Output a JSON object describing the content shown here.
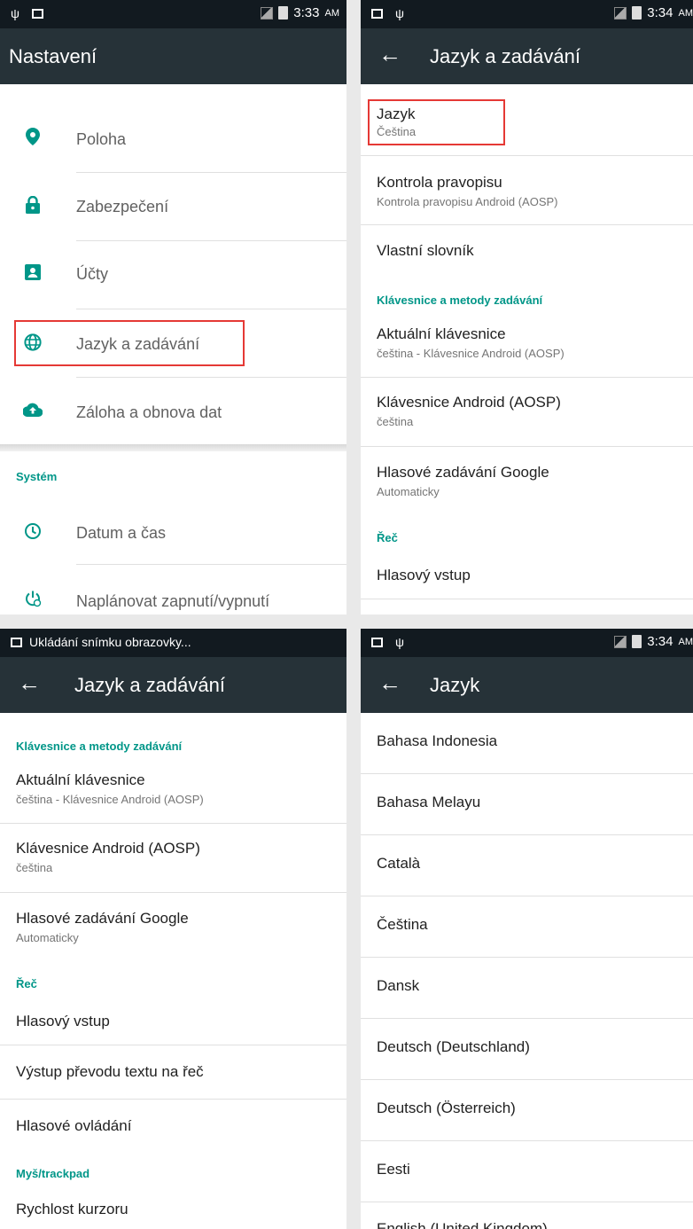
{
  "panel1": {
    "time": "3:33",
    "ampm": "AM",
    "title": "Nastavení",
    "items": [
      {
        "label": "Poloha",
        "icon": "location-pin-icon"
      },
      {
        "label": "Zabezpečení",
        "icon": "lock-icon"
      },
      {
        "label": "Účty",
        "icon": "account-icon"
      },
      {
        "label": "Jazyk a zadávání",
        "icon": "globe-icon"
      },
      {
        "label": "Záloha a obnova dat",
        "icon": "cloud-upload-icon"
      }
    ],
    "system_header": "Systém",
    "system_items": [
      {
        "label": "Datum a čas",
        "icon": "clock-icon"
      },
      {
        "label": "Naplánovat zapnutí/vypnutí",
        "icon": "power-schedule-icon"
      }
    ]
  },
  "panel2": {
    "time": "3:34",
    "ampm": "AM",
    "title": "Jazyk a zadávání",
    "language": {
      "label": "Jazyk",
      "value": "Čeština"
    },
    "spellcheck": {
      "label": "Kontrola pravopisu",
      "value": "Kontrola pravopisu Android (AOSP)"
    },
    "dictionary": "Vlastní slovník",
    "keyboard_header": "Klávesnice a metody zadávání",
    "current_keyboard": {
      "label": "Aktuální klávesnice",
      "value": "čeština - Klávesnice Android (AOSP)"
    },
    "aosp_keyboard": {
      "label": "Klávesnice Android (AOSP)",
      "value": "čeština"
    },
    "google_voice": {
      "label": "Hlasové zadávání Google",
      "value": "Automaticky"
    },
    "speech_header": "Řeč",
    "voice_input": "Hlasový vstup"
  },
  "panel3": {
    "status_text": "Ukládání snímku obrazovky...",
    "title": "Jazyk a zadávání",
    "keyboard_header": "Klávesnice a metody zadávání",
    "current_keyboard": {
      "label": "Aktuální klávesnice",
      "value": "čeština - Klávesnice Android (AOSP)"
    },
    "aosp_keyboard": {
      "label": "Klávesnice Android (AOSP)",
      "value": "čeština"
    },
    "google_voice": {
      "label": "Hlasové zadávání Google",
      "value": "Automaticky"
    },
    "speech_header": "Řeč",
    "voice_input": "Hlasový vstup",
    "tts_output": "Výstup převodu textu na řeč",
    "voice_control": "Hlasové ovládání",
    "mouse_header": "Myš/trackpad",
    "pointer_speed": "Rychlost kurzoru"
  },
  "panel4": {
    "time": "3:34",
    "ampm": "AM",
    "title": "Jazyk",
    "languages": [
      "Bahasa Indonesia",
      "Bahasa Melayu",
      "Català",
      "Čeština",
      "Dansk",
      "Deutsch (Deutschland)",
      "Deutsch (Österreich)",
      "Eesti",
      "English (United Kingdom)"
    ]
  },
  "colors": {
    "toolbar": "#263238",
    "status": "#121a20",
    "accent": "#009688",
    "highlight": "#e53935"
  }
}
